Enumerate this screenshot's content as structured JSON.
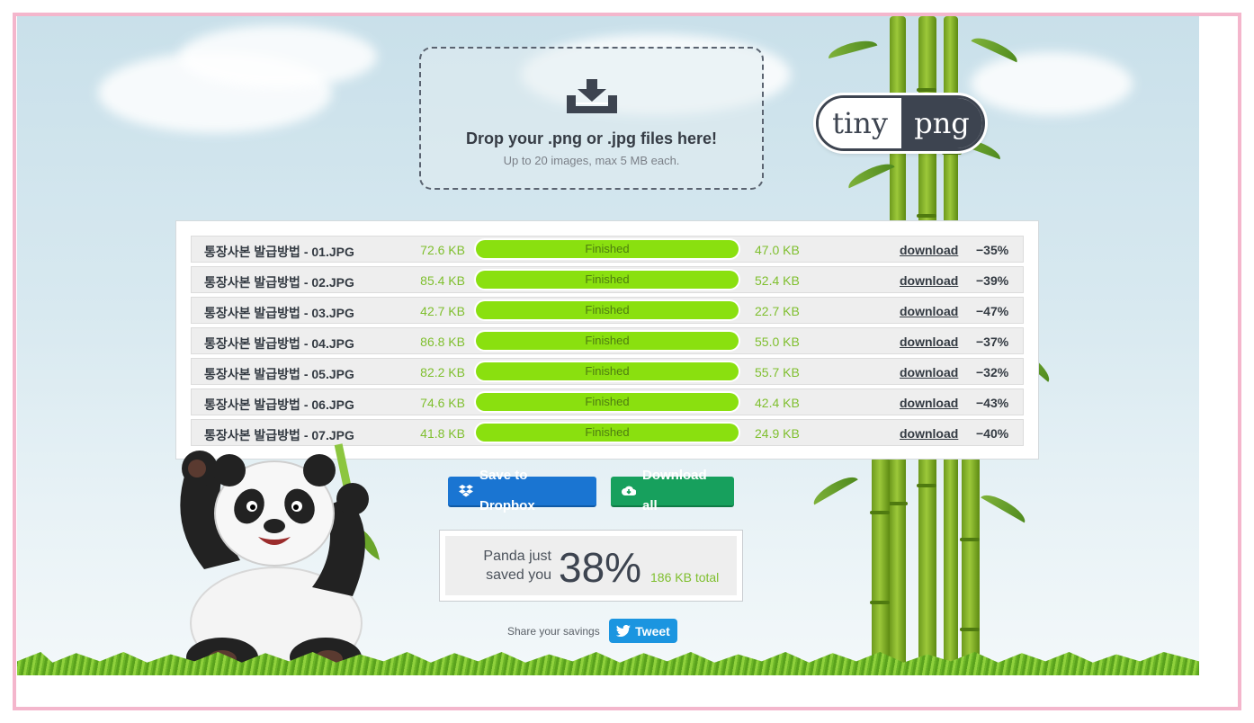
{
  "dropzone": {
    "title": "Drop your .png or .jpg files here!",
    "subtitle": "Up to 20 images, max 5 MB each.",
    "icon": "download-tray-icon"
  },
  "logo": {
    "left": "tiny",
    "right": "png"
  },
  "files": [
    {
      "name": "통장사본 발급방법 - 01.JPG",
      "original_size": "72.6 KB",
      "status": "Finished",
      "new_size": "47.0 KB",
      "download_label": "download",
      "saving": "−35%",
      "progress": 100
    },
    {
      "name": "통장사본 발급방법 - 02.JPG",
      "original_size": "85.4 KB",
      "status": "Finished",
      "new_size": "52.4 KB",
      "download_label": "download",
      "saving": "−39%",
      "progress": 100
    },
    {
      "name": "통장사본 발급방법 - 03.JPG",
      "original_size": "42.7 KB",
      "status": "Finished",
      "new_size": "22.7 KB",
      "download_label": "download",
      "saving": "−47%",
      "progress": 100
    },
    {
      "name": "통장사본 발급방법 - 04.JPG",
      "original_size": "86.8 KB",
      "status": "Finished",
      "new_size": "55.0 KB",
      "download_label": "download",
      "saving": "−37%",
      "progress": 100
    },
    {
      "name": "통장사본 발급방법 - 05.JPG",
      "original_size": "82.2 KB",
      "status": "Finished",
      "new_size": "55.7 KB",
      "download_label": "download",
      "saving": "−32%",
      "progress": 100
    },
    {
      "name": "통장사본 발급방법 - 06.JPG",
      "original_size": "74.6 KB",
      "status": "Finished",
      "new_size": "42.4 KB",
      "download_label": "download",
      "saving": "−43%",
      "progress": 100
    },
    {
      "name": "통장사본 발급방법 - 07.JPG",
      "original_size": "41.8 KB",
      "status": "Finished",
      "new_size": "24.9 KB",
      "download_label": "download",
      "saving": "−40%",
      "progress": 100
    }
  ],
  "actions": {
    "dropbox_label": "Save to Dropbox",
    "download_all_label": "Download all"
  },
  "savings": {
    "label_line1": "Panda just",
    "label_line2": "saved you",
    "percent": "38%",
    "total": "186 KB total"
  },
  "share": {
    "label": "Share your savings",
    "tweet_label": "Tweet"
  },
  "colors": {
    "progress": "#8ae00f",
    "size_text": "#7fbf2e",
    "dropbox": "#1a75d2",
    "download_all": "#17a05d",
    "tweet": "#1b95e0",
    "frame": "#f4b6cc"
  }
}
